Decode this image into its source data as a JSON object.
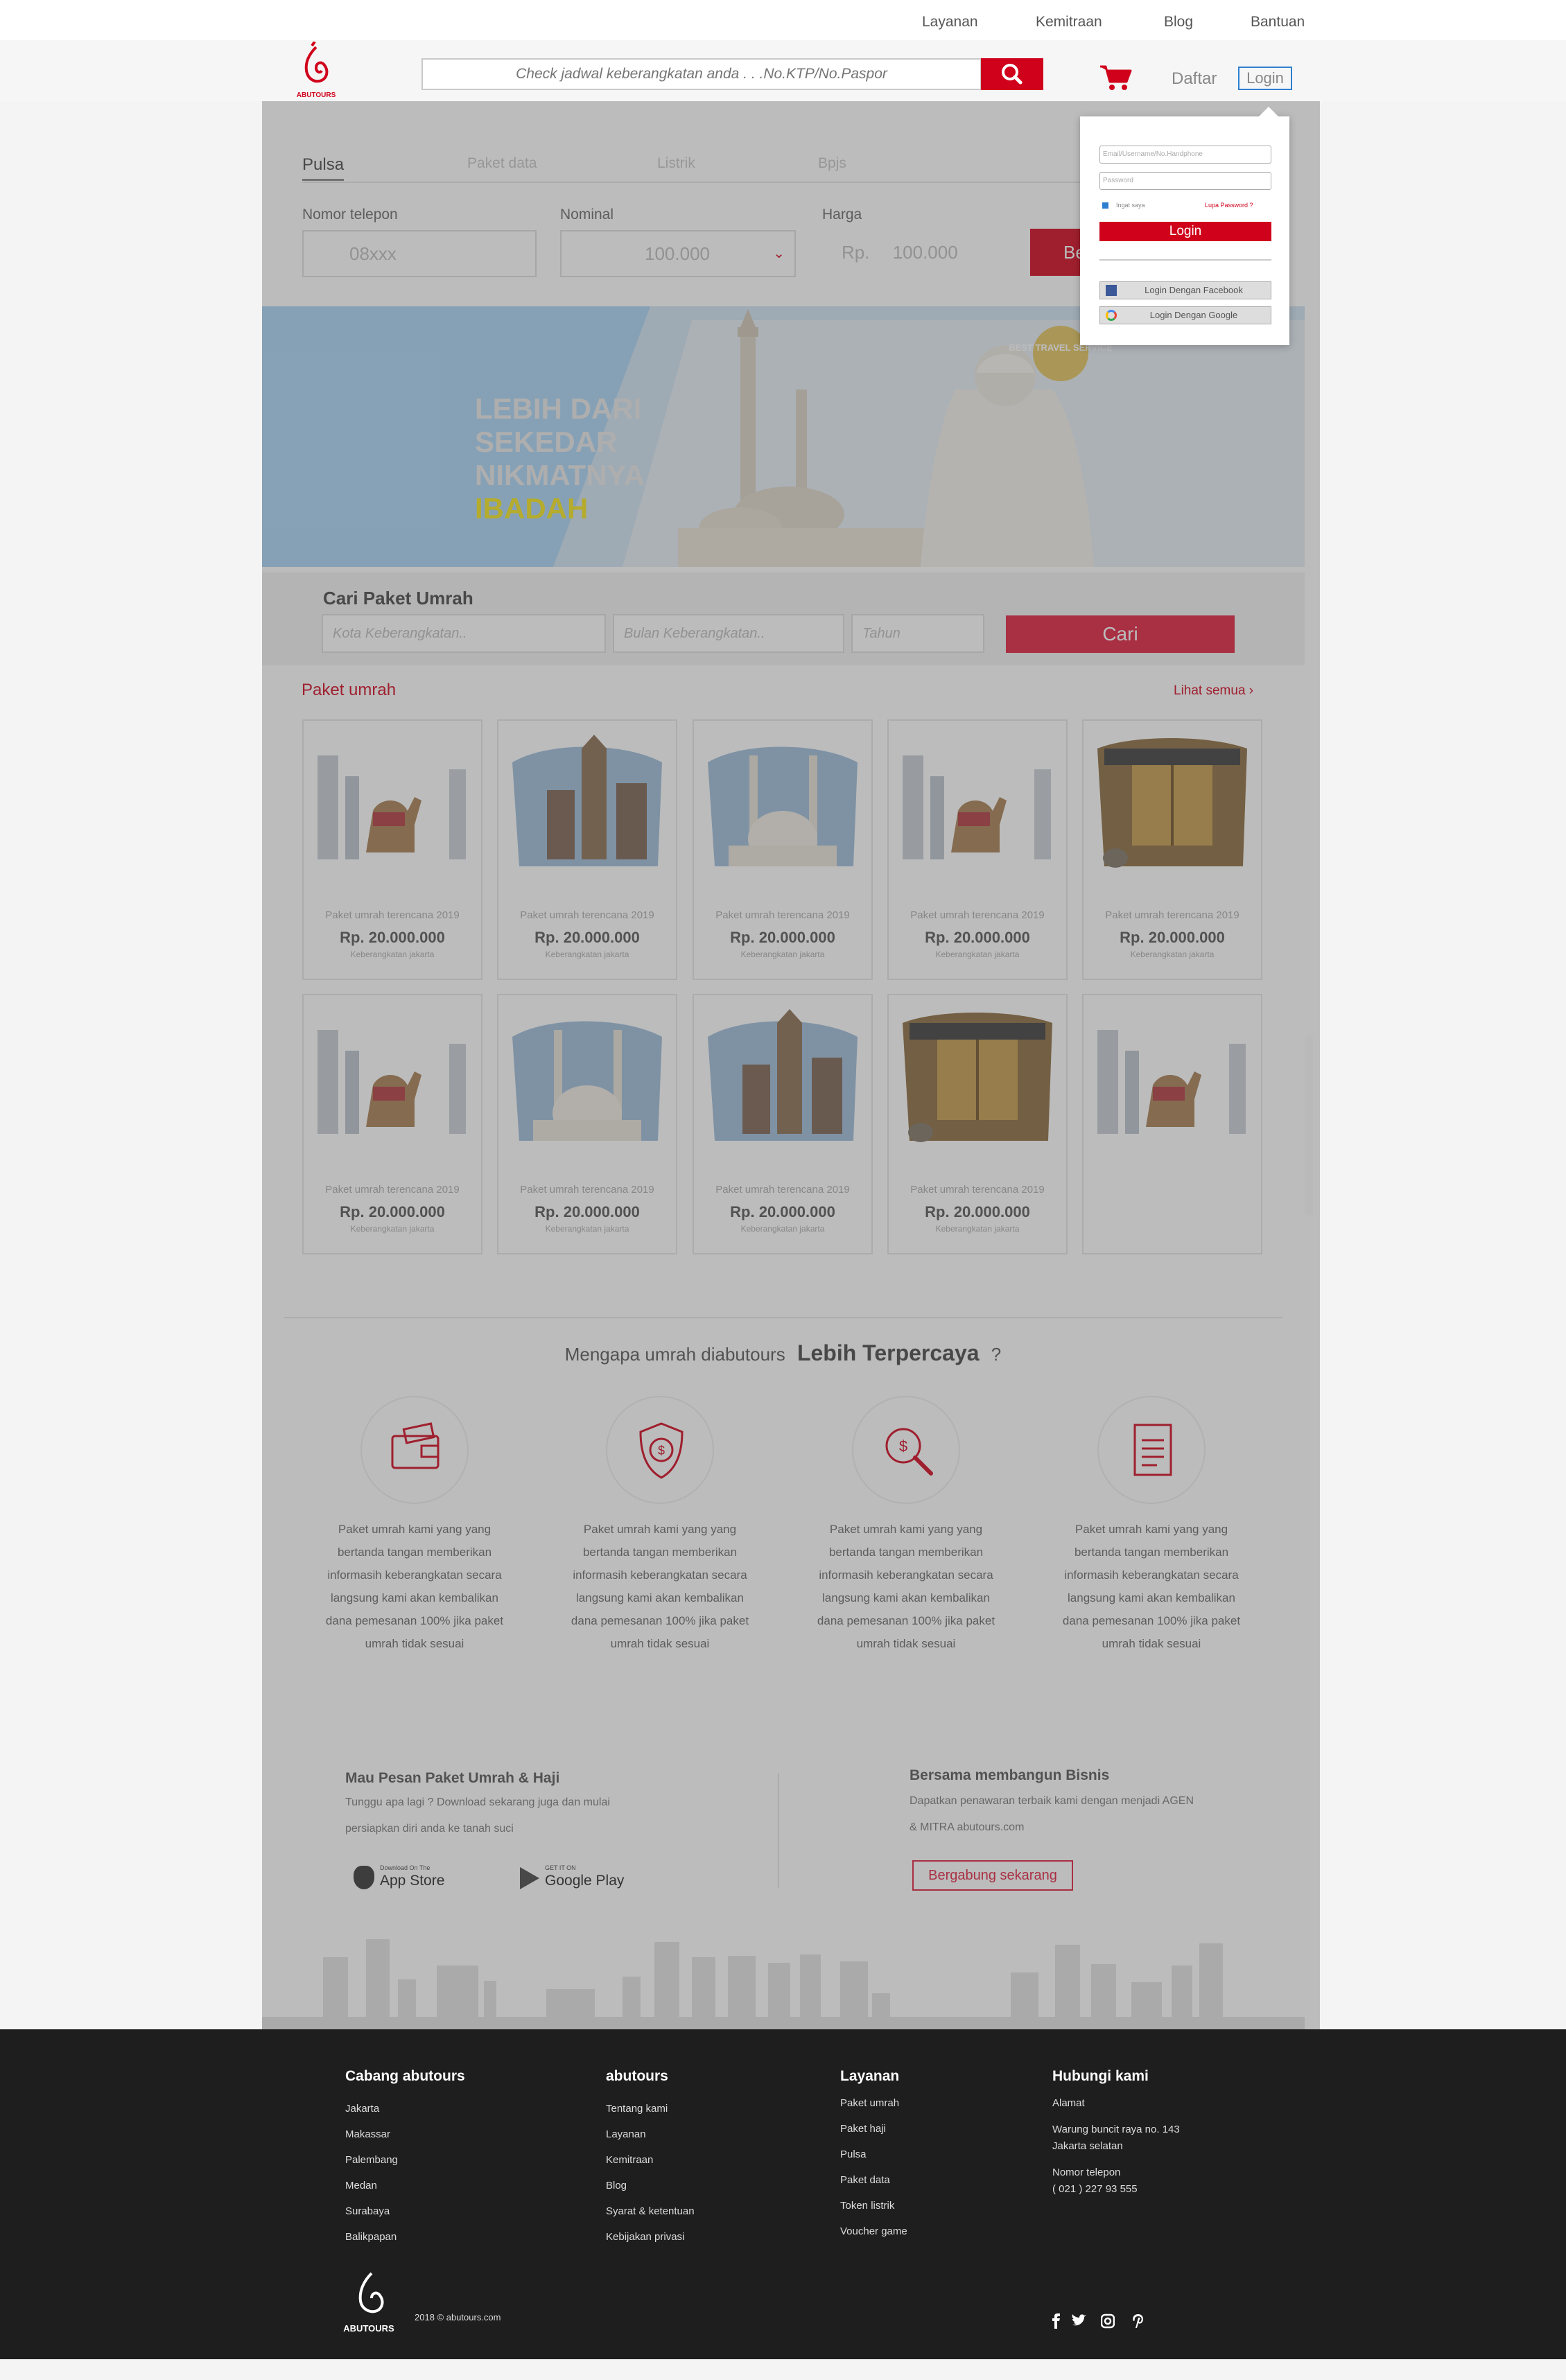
{
  "topnav": {
    "items": [
      "Layanan",
      "Kemitraan",
      "Blog",
      "Bantuan"
    ]
  },
  "header": {
    "logo_text": "ABUTOURS",
    "search_placeholder": "Check jadwal keberangkatan anda . . .No.KTP/No.Paspor",
    "daftar": "Daftar",
    "login": "Login"
  },
  "topup": {
    "tabs": [
      "Pulsa",
      "Paket data",
      "Listrik",
      "Bpjs"
    ],
    "phone_label": "Nomor telepon",
    "phone_placeholder": "08xxx",
    "nominal_label": "Nominal",
    "nominal_value": "100.000",
    "harga_label": "Harga",
    "harga_prefix": "Rp.",
    "harga_value": "100.000",
    "beli": "Beli"
  },
  "banner": {
    "line1": "LEBIH DARI",
    "line2": "SEKEDAR",
    "line3": "NIKMATNYA",
    "line4": "IBADAH",
    "badge": "BEST TRAVEL SERVICE"
  },
  "cari": {
    "title": "Cari Paket Umrah",
    "kota": "Kota Keberangkatan..",
    "bulan": "Bulan Keberangkatan..",
    "tahun": "Tahun",
    "button": "Cari"
  },
  "paket": {
    "title": "Paket umrah",
    "lihat": "Lihat semua",
    "caption": "Paket umrah terencana 2019",
    "price": "Rp. 20.000.000",
    "loc": "Keberangkatan jakarta"
  },
  "why": {
    "prefix": "Mengapa umrah diabutours",
    "bold": "Lebih Terpercaya",
    "suffix": "?",
    "text": "Paket umrah kami yang yang bertanda tangan memberikan informasih keberangkatan secara langsung kami akan kembalikan dana pemesanan 100% jika paket umrah tidak sesuai"
  },
  "app": {
    "title": "Mau Pesan Paket Umrah & Haji",
    "desc1": "Tunggu apa lagi ? Download sekarang juga dan mulai",
    "desc2": "persiapkan diri anda ke tanah suci",
    "appstore_small": "Download On The",
    "appstore": "App Store",
    "play_small": "GET IT ON",
    "play": "Google Play"
  },
  "mitra": {
    "title": "Bersama membangun Bisnis",
    "desc1": "Dapatkan penawaran terbaik kami dengan menjadi AGEN",
    "desc2": "& MITRA abutours.com",
    "button": "Bergabung sekarang"
  },
  "footer": {
    "cabang_title": "Cabang abutours",
    "cabang": [
      "Jakarta",
      "Makassar",
      "Palembang",
      "Medan",
      "Surabaya",
      "Balikpapan"
    ],
    "abu_title": "abutours",
    "abu": [
      "Tentang kami",
      "Layanan",
      "Kemitraan",
      "Blog",
      "Syarat & ketentuan",
      "Kebijakan privasi"
    ],
    "layanan_title": "Layanan",
    "layanan": [
      "Paket umrah",
      "Paket haji",
      "Pulsa",
      "Paket data",
      "Token listrik",
      "Voucher game"
    ],
    "hubungi_title": "Hubungi kami",
    "alamat_label": "Alamat",
    "alamat1": "Warung buncit raya no. 143",
    "alamat2": "Jakarta selatan",
    "telp_label": "Nomor telepon",
    "telp": "( 021 )  227 93 555",
    "copyright": "2018 © abutours.com"
  },
  "login_dropdown": {
    "user_placeholder": "Email/Username/No.Handphone",
    "password_placeholder": "Password",
    "ingat": "Ingat saya",
    "lupa": "Lupa Password ?",
    "login": "Login",
    "facebook": "Login Dengan Facebook",
    "google": "Login Dengan Google"
  },
  "colors": {
    "accent": "#d0021b",
    "footer_bg": "#1e1e1e",
    "banner_bg": "#a9d4f5",
    "banner_yellow": "#f4e51a"
  }
}
